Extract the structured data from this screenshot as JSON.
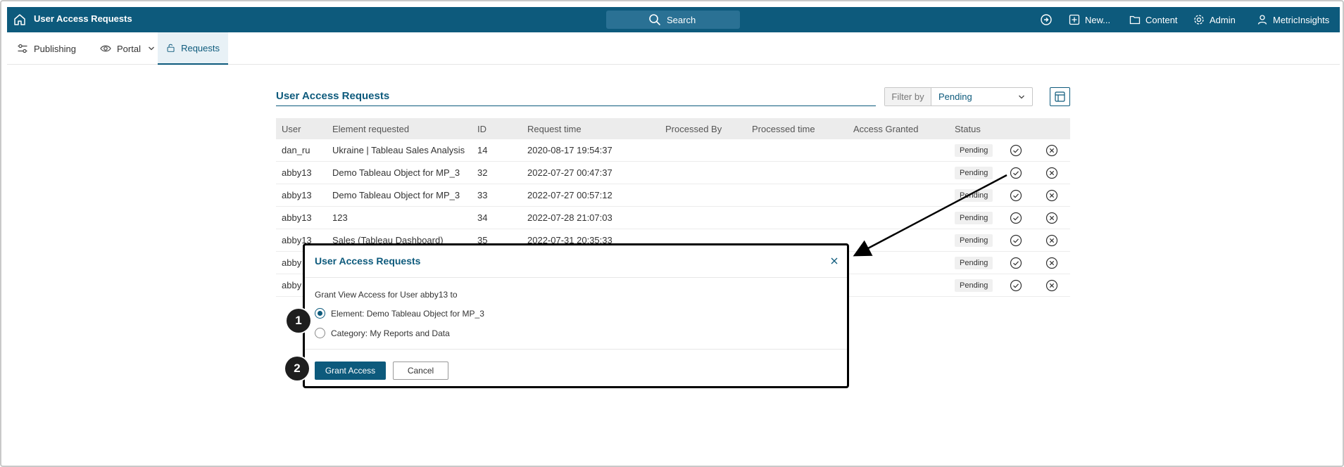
{
  "app": {
    "title": "User Access Requests",
    "search_label": "Search",
    "nav": [
      "New...",
      "Content",
      "Admin",
      "MetricInsights"
    ]
  },
  "subnav": {
    "items": [
      "Publishing",
      "Portal",
      "Requests"
    ],
    "active": "Requests"
  },
  "page": {
    "title": "User Access Requests",
    "filter_label": "Filter by",
    "filter_value": "Pending"
  },
  "table": {
    "columns": [
      "User",
      "Element requested",
      "ID",
      "Request time",
      "Processed By",
      "Processed time",
      "Access Granted",
      "Status"
    ],
    "rows": [
      {
        "user": "dan_ru",
        "element": "Ukraine | Tableau Sales Analysis",
        "id": "14",
        "time": "2020-08-17 19:54:37",
        "status": "Pending"
      },
      {
        "user": "abby13",
        "element": "Demo Tableau Object for MP_3",
        "id": "32",
        "time": "2022-07-27 00:47:37",
        "status": "Pending"
      },
      {
        "user": "abby13",
        "element": "Demo Tableau Object for MP_3",
        "id": "33",
        "time": "2022-07-27 00:57:12",
        "status": "Pending"
      },
      {
        "user": "abby13",
        "element": "123",
        "id": "34",
        "time": "2022-07-28 21:07:03",
        "status": "Pending"
      },
      {
        "user": "abby13",
        "element": "Sales (Tableau Dashboard)",
        "id": "35",
        "time": "2022-07-31 20:35:33",
        "status": "Pending"
      },
      {
        "user": "abby",
        "element": "",
        "id": "",
        "time": "",
        "status": "Pending"
      },
      {
        "user": "abby",
        "element": "",
        "id": "",
        "time": "",
        "status": "Pending"
      }
    ]
  },
  "modal": {
    "title": "User Access Requests",
    "prompt": "Grant View Access for User abby13 to",
    "options": [
      "Element: Demo Tableau Object for MP_3",
      "Category: My Reports and Data"
    ],
    "selected_option": 0,
    "grant_label": "Grant Access",
    "cancel_label": "Cancel"
  },
  "callouts": [
    "1",
    "2"
  ],
  "colors": {
    "brand": "#0d5a7c",
    "header_bg": "#0d5a7c"
  }
}
